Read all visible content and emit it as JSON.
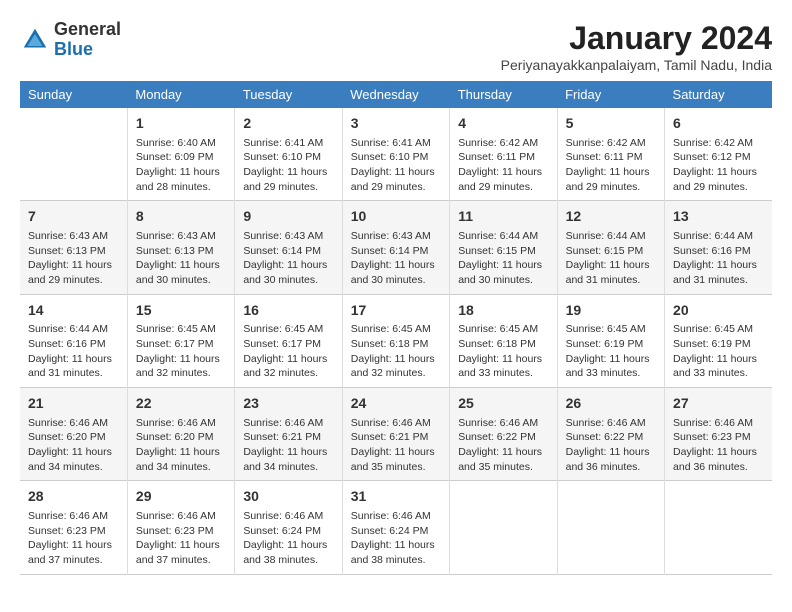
{
  "logo": {
    "general": "General",
    "blue": "Blue"
  },
  "title": "January 2024",
  "subtitle": "Periyanayakkanpalaiyam, Tamil Nadu, India",
  "days_of_week": [
    "Sunday",
    "Monday",
    "Tuesday",
    "Wednesday",
    "Thursday",
    "Friday",
    "Saturday"
  ],
  "weeks": [
    [
      {
        "day": "",
        "info": ""
      },
      {
        "day": "1",
        "info": "Sunrise: 6:40 AM\nSunset: 6:09 PM\nDaylight: 11 hours\nand 28 minutes."
      },
      {
        "day": "2",
        "info": "Sunrise: 6:41 AM\nSunset: 6:10 PM\nDaylight: 11 hours\nand 29 minutes."
      },
      {
        "day": "3",
        "info": "Sunrise: 6:41 AM\nSunset: 6:10 PM\nDaylight: 11 hours\nand 29 minutes."
      },
      {
        "day": "4",
        "info": "Sunrise: 6:42 AM\nSunset: 6:11 PM\nDaylight: 11 hours\nand 29 minutes."
      },
      {
        "day": "5",
        "info": "Sunrise: 6:42 AM\nSunset: 6:11 PM\nDaylight: 11 hours\nand 29 minutes."
      },
      {
        "day": "6",
        "info": "Sunrise: 6:42 AM\nSunset: 6:12 PM\nDaylight: 11 hours\nand 29 minutes."
      }
    ],
    [
      {
        "day": "7",
        "info": "Sunrise: 6:43 AM\nSunset: 6:13 PM\nDaylight: 11 hours\nand 29 minutes."
      },
      {
        "day": "8",
        "info": "Sunrise: 6:43 AM\nSunset: 6:13 PM\nDaylight: 11 hours\nand 30 minutes."
      },
      {
        "day": "9",
        "info": "Sunrise: 6:43 AM\nSunset: 6:14 PM\nDaylight: 11 hours\nand 30 minutes."
      },
      {
        "day": "10",
        "info": "Sunrise: 6:43 AM\nSunset: 6:14 PM\nDaylight: 11 hours\nand 30 minutes."
      },
      {
        "day": "11",
        "info": "Sunrise: 6:44 AM\nSunset: 6:15 PM\nDaylight: 11 hours\nand 30 minutes."
      },
      {
        "day": "12",
        "info": "Sunrise: 6:44 AM\nSunset: 6:15 PM\nDaylight: 11 hours\nand 31 minutes."
      },
      {
        "day": "13",
        "info": "Sunrise: 6:44 AM\nSunset: 6:16 PM\nDaylight: 11 hours\nand 31 minutes."
      }
    ],
    [
      {
        "day": "14",
        "info": "Sunrise: 6:44 AM\nSunset: 6:16 PM\nDaylight: 11 hours\nand 31 minutes."
      },
      {
        "day": "15",
        "info": "Sunrise: 6:45 AM\nSunset: 6:17 PM\nDaylight: 11 hours\nand 32 minutes."
      },
      {
        "day": "16",
        "info": "Sunrise: 6:45 AM\nSunset: 6:17 PM\nDaylight: 11 hours\nand 32 minutes."
      },
      {
        "day": "17",
        "info": "Sunrise: 6:45 AM\nSunset: 6:18 PM\nDaylight: 11 hours\nand 32 minutes."
      },
      {
        "day": "18",
        "info": "Sunrise: 6:45 AM\nSunset: 6:18 PM\nDaylight: 11 hours\nand 33 minutes."
      },
      {
        "day": "19",
        "info": "Sunrise: 6:45 AM\nSunset: 6:19 PM\nDaylight: 11 hours\nand 33 minutes."
      },
      {
        "day": "20",
        "info": "Sunrise: 6:45 AM\nSunset: 6:19 PM\nDaylight: 11 hours\nand 33 minutes."
      }
    ],
    [
      {
        "day": "21",
        "info": "Sunrise: 6:46 AM\nSunset: 6:20 PM\nDaylight: 11 hours\nand 34 minutes."
      },
      {
        "day": "22",
        "info": "Sunrise: 6:46 AM\nSunset: 6:20 PM\nDaylight: 11 hours\nand 34 minutes."
      },
      {
        "day": "23",
        "info": "Sunrise: 6:46 AM\nSunset: 6:21 PM\nDaylight: 11 hours\nand 34 minutes."
      },
      {
        "day": "24",
        "info": "Sunrise: 6:46 AM\nSunset: 6:21 PM\nDaylight: 11 hours\nand 35 minutes."
      },
      {
        "day": "25",
        "info": "Sunrise: 6:46 AM\nSunset: 6:22 PM\nDaylight: 11 hours\nand 35 minutes."
      },
      {
        "day": "26",
        "info": "Sunrise: 6:46 AM\nSunset: 6:22 PM\nDaylight: 11 hours\nand 36 minutes."
      },
      {
        "day": "27",
        "info": "Sunrise: 6:46 AM\nSunset: 6:23 PM\nDaylight: 11 hours\nand 36 minutes."
      }
    ],
    [
      {
        "day": "28",
        "info": "Sunrise: 6:46 AM\nSunset: 6:23 PM\nDaylight: 11 hours\nand 37 minutes."
      },
      {
        "day": "29",
        "info": "Sunrise: 6:46 AM\nSunset: 6:23 PM\nDaylight: 11 hours\nand 37 minutes."
      },
      {
        "day": "30",
        "info": "Sunrise: 6:46 AM\nSunset: 6:24 PM\nDaylight: 11 hours\nand 38 minutes."
      },
      {
        "day": "31",
        "info": "Sunrise: 6:46 AM\nSunset: 6:24 PM\nDaylight: 11 hours\nand 38 minutes."
      },
      {
        "day": "",
        "info": ""
      },
      {
        "day": "",
        "info": ""
      },
      {
        "day": "",
        "info": ""
      }
    ]
  ]
}
